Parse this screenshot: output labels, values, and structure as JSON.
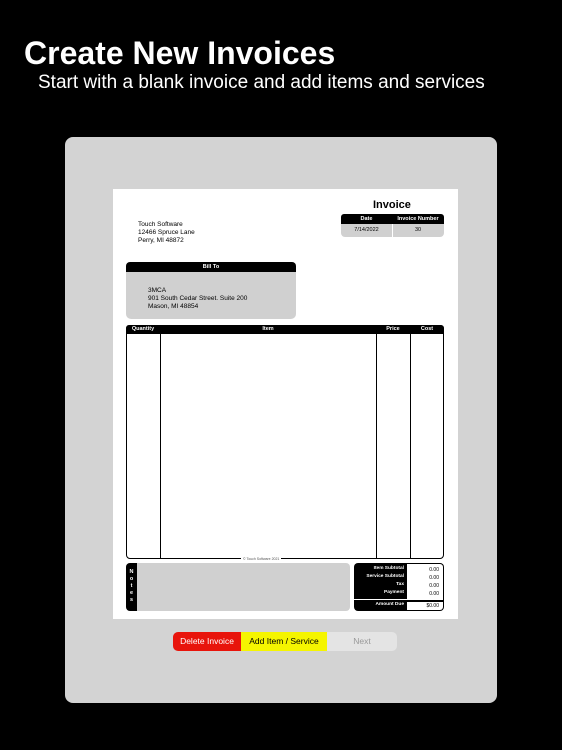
{
  "promo": {
    "headline": "Create New Invoices",
    "subline": "Start with a blank invoice and add items and services"
  },
  "invoice": {
    "title": "Invoice",
    "meta": {
      "date_label": "Date",
      "number_label": "Invoice Number",
      "date": "7/14/2022",
      "number": "30"
    },
    "from": {
      "name": "Touch Software",
      "street": "12466 Spruce Lane",
      "city": "Perry, MI  48872"
    },
    "bill_to": {
      "label": "Bill To",
      "name": "3MCA",
      "street": "901 South Cedar Street. Suite 200",
      "city": "Mason, MI  48854"
    },
    "columns": {
      "quantity": "Quantity",
      "item": "Item",
      "price": "Price",
      "cost": "Cost"
    },
    "copyright": "© Touch Software 2021",
    "notes_label": [
      "N",
      "o",
      "t",
      "e",
      "s"
    ],
    "totals": {
      "item_subtotal_label": "Item Subtotal",
      "service_subtotal_label": "Service Subtotal",
      "tax_label": "Tax",
      "payment_label": "Payment",
      "amount_due_label": "Amount Due",
      "item_subtotal": "0.00",
      "service_subtotal": "0.00",
      "tax": "0.00",
      "payment": "0.00",
      "amount_due": "$0.00"
    }
  },
  "actions": {
    "delete": "Delete Invoice",
    "add": "Add Item / Service",
    "next": "Next"
  },
  "colors": {
    "delete": "#e8140b",
    "add": "#f5f500",
    "next": "#e4e4e4"
  }
}
